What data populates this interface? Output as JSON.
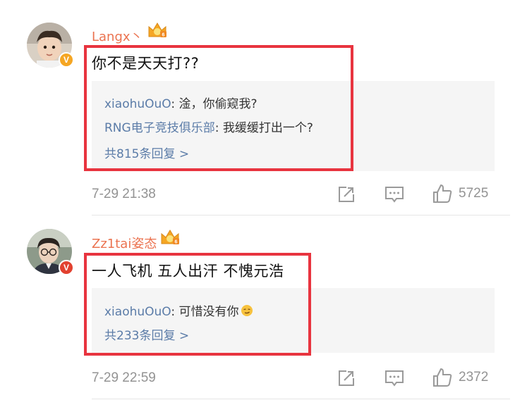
{
  "comments": [
    {
      "username": "Langx丶",
      "avatar_badge": "V",
      "text": "你不是天天打??",
      "replies": [
        {
          "name": "xiaohuOuO",
          "text": ": 淦，你偷窥我?"
        },
        {
          "name": "RNG电子竞技俱乐部",
          "text": ": 我缓缓打出一个?"
        }
      ],
      "more_replies": "共815条回复 >",
      "timestamp": "7-29 21:38",
      "likes": "5725"
    },
    {
      "username": "Zz1tai姿态",
      "avatar_badge": "V",
      "text": "一人飞机 五人出汗 不愧元浩",
      "replies": [
        {
          "name": "xiaohuOuO",
          "text": ": 可惜没有你"
        }
      ],
      "more_replies": "共233条回复 >",
      "timestamp": "7-29 22:59",
      "likes": "2372"
    }
  ],
  "colors": {
    "username": "#eb7350",
    "link": "#5b7ca8",
    "highlight_frame": "#e8343f",
    "meta": "#939393"
  }
}
